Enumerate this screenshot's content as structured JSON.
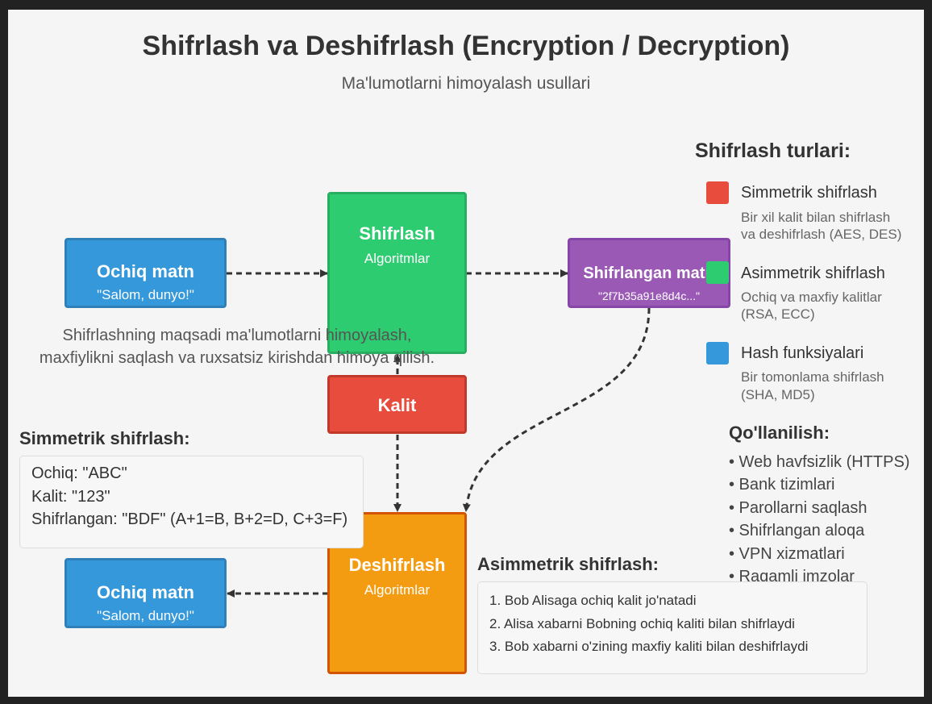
{
  "title": "Shifrlash va Deshifrlash (Encryption / Decryption)",
  "subtitle": "Ma'lumotlarni himoyalash usullari",
  "nodes": {
    "plaintext": {
      "label": "Ochiq matn",
      "value": "\"Salom, dunyo!\""
    },
    "encrypt": {
      "label": "Shifrlash",
      "sub": "Algoritmlar"
    },
    "ciphertext": {
      "label": "Shifrlangan matn",
      "value": "\"2f7b35a91e8d4c...\""
    },
    "key": {
      "label": "Kalit"
    },
    "decrypt": {
      "label": "Deshifrlash",
      "sub": "Algoritmlar"
    },
    "result": {
      "label": "Ochiq matn",
      "value": "\"Salom, dunyo!\""
    }
  },
  "purpose_note": {
    "line1": "Shifrlashning maqsadi ma'lumotlarni himoyalash,",
    "line2": "maxfiylikni saqlash va ruxsatsiz kirishdan himoya qilish."
  },
  "types": {
    "heading": "Shifrlash turlari:",
    "items": [
      {
        "name": "Simmetrik shifrlash",
        "desc1": "Bir xil kalit bilan shifrlash",
        "desc2": "va deshifrlash (AES, DES)",
        "color": "#e74c3c"
      },
      {
        "name": "Asimmetrik shifrlash",
        "desc1": "Ochiq va maxfiy kalitlar",
        "desc2": "(RSA, ECC)",
        "color": "#2ecc71"
      },
      {
        "name": "Hash funksiyalari",
        "desc1": "Bir tomonlama shifrlash",
        "desc2": "(SHA, MD5)",
        "color": "#3498db"
      }
    ]
  },
  "usage": {
    "heading": "Qo'llanilish:",
    "items": [
      "• Web havfsizlik (HTTPS)",
      "• Bank tizimlari",
      "• Parollarni saqlash",
      "• Shifrlangan aloqa",
      "• VPN xizmatlari",
      "• Raqamli imzolar"
    ]
  },
  "symmetric_example": {
    "heading": "Simmetrik shifrlash:",
    "lines": [
      "Ochiq: \"ABC\"",
      "Kalit: \"123\"",
      "Shifrlangan: \"BDF\" (A+1=B, B+2=D, C+3=F)"
    ]
  },
  "asymmetric_example": {
    "heading": "Asimmetrik shifrlash:",
    "lines": [
      "1. Bob Alisaga ochiq kalit jo'natadi",
      "2. Alisa xabarni Bobning ochiq kaliti bilan shifrlaydi",
      "3. Bob xabarni o'zining maxfiy kaliti bilan deshifrlaydi"
    ]
  },
  "colors": {
    "plaintext": "#3498db",
    "encrypt": "#2ecc71",
    "ciphertext": "#9b59b6",
    "key": "#e74c3c",
    "decrypt": "#f39c12",
    "arrow": "#333333"
  }
}
